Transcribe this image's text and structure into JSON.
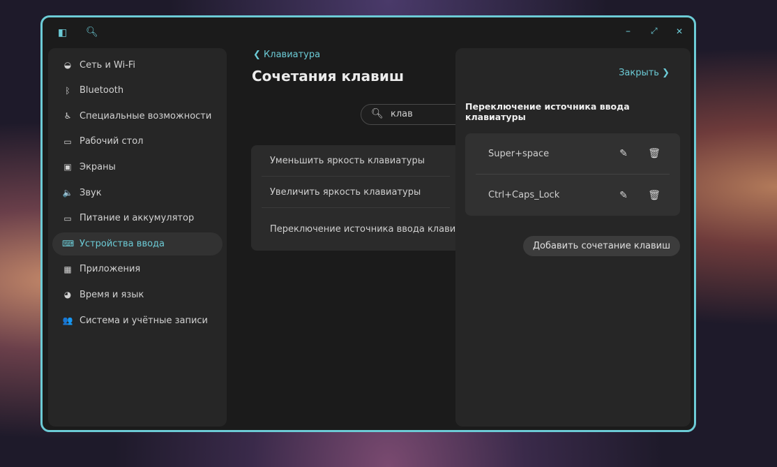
{
  "window": {
    "accent": "#6ccbd6",
    "controls": {
      "minimize": "–",
      "maximize": "⤢",
      "close": "✕"
    }
  },
  "sidebar": {
    "items": [
      {
        "label": "Сеть и Wi-Fi",
        "icon": "wifi-icon",
        "glyph": "◒"
      },
      {
        "label": "Bluetooth",
        "icon": "bluetooth-icon",
        "glyph": "ᛒ"
      },
      {
        "label": "Специальные возможности",
        "icon": "accessibility-icon",
        "glyph": "♿"
      },
      {
        "label": "Рабочий стол",
        "icon": "desktop-icon",
        "glyph": "▭"
      },
      {
        "label": "Экраны",
        "icon": "display-icon",
        "glyph": "▣"
      },
      {
        "label": "Звук",
        "icon": "speaker-icon",
        "glyph": "🔈"
      },
      {
        "label": "Питание и аккумулятор",
        "icon": "battery-icon",
        "glyph": "▭"
      },
      {
        "label": "Устройства ввода",
        "icon": "keyboard-icon",
        "glyph": "⌨",
        "active": true
      },
      {
        "label": "Приложения",
        "icon": "apps-grid-icon",
        "glyph": "▦"
      },
      {
        "label": "Время и язык",
        "icon": "time-language-icon",
        "glyph": "◕"
      },
      {
        "label": "Система и учётные записи",
        "icon": "users-icon",
        "glyph": "👥"
      }
    ]
  },
  "main": {
    "back_label": "Клавиатура",
    "title": "Сочетания клавиш",
    "search_value": "клав",
    "results": [
      "Уменьшить яркость клавиатуры",
      "Увеличить яркость клавиатуры",
      "Переключение источника ввода клавиатуры"
    ]
  },
  "panel": {
    "close_label": "Закрыть",
    "title": "Переключение источника ввода клавиатуры",
    "shortcuts": [
      "Super+space",
      "Ctrl+Caps_Lock"
    ],
    "add_label": "Добавить сочетание клавиш"
  }
}
